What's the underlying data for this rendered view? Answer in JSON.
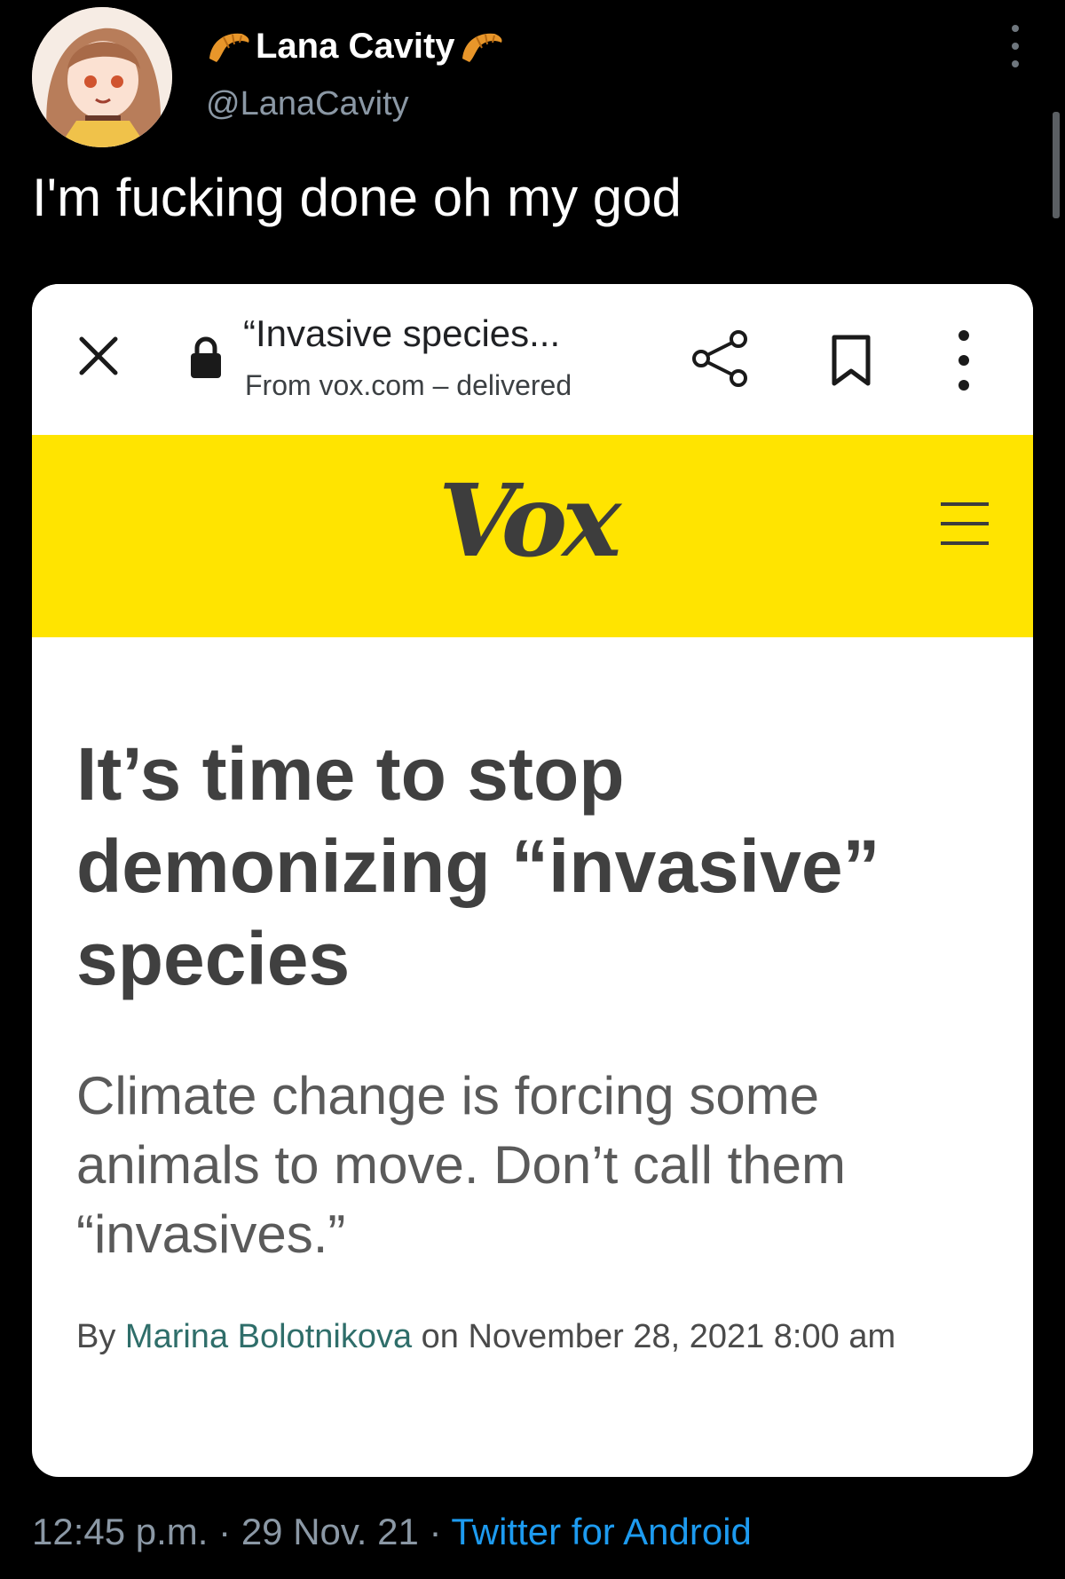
{
  "author": {
    "display_name": "Lana Cavity",
    "handle": "@LanaCavity",
    "name_decoration_icon": "croissant-icon"
  },
  "tweet": {
    "text": "I'm fucking done oh my god",
    "time": "12:45 p.m.",
    "separator": "·",
    "date": "29 Nov. 21",
    "source": "Twitter for Android"
  },
  "browser": {
    "title": "“Invasive species...",
    "source": "From vox.com – delivered",
    "icons": [
      "close-icon",
      "lock-icon",
      "share-icon",
      "bookmark-icon",
      "more-vertical-icon"
    ]
  },
  "article": {
    "site_logo": "Vox",
    "headline": "It’s time to stop demonizing “invasive” species",
    "dek": "Climate change is forcing some animals to move. Don’t call them “invasives.”",
    "byline_prefix": "By",
    "author": "Marina Bolotnikova",
    "date_text": "on November 28, 2021 8:00 am"
  },
  "colors": {
    "background": "#000000",
    "vox_yellow": "#ffe400",
    "link_blue": "#1d9bf0",
    "author_link": "#2f6e6a"
  }
}
